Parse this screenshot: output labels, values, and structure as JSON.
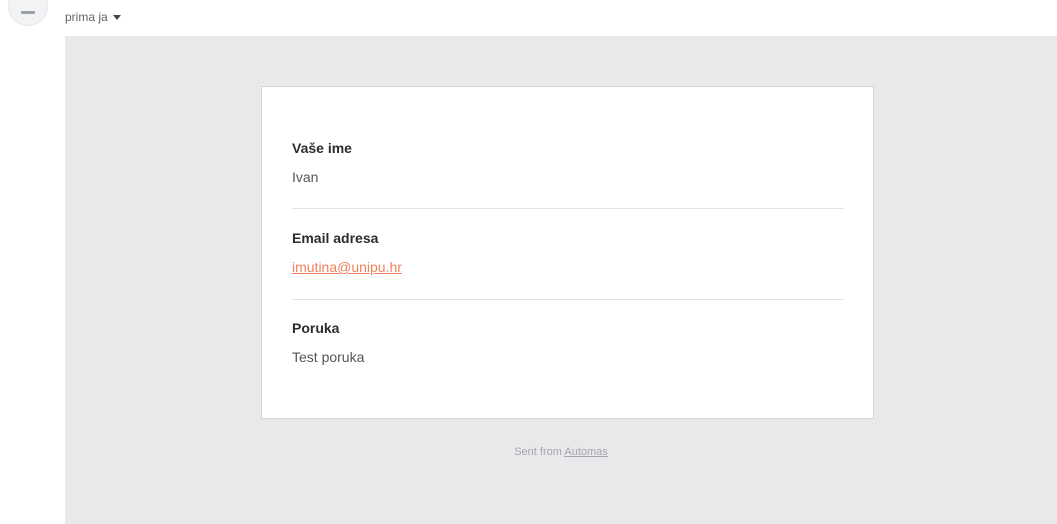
{
  "header": {
    "recipient_label": "prima ja"
  },
  "form": {
    "fields": [
      {
        "label": "Vaše ime",
        "value": "Ivan"
      },
      {
        "label": "Email adresa",
        "value": "imutina@unipu.hr"
      },
      {
        "label": "Poruka",
        "value": "Test poruka"
      }
    ]
  },
  "footer": {
    "prefix": "Sent from ",
    "link_text": "Automas"
  },
  "colors": {
    "link": "#f0835f",
    "body_background": "#e8e9eb",
    "card_background": "#ffffff"
  },
  "icons": {
    "avatar": "avatar-icon",
    "recipient_dropdown": "chevron-down-icon"
  }
}
